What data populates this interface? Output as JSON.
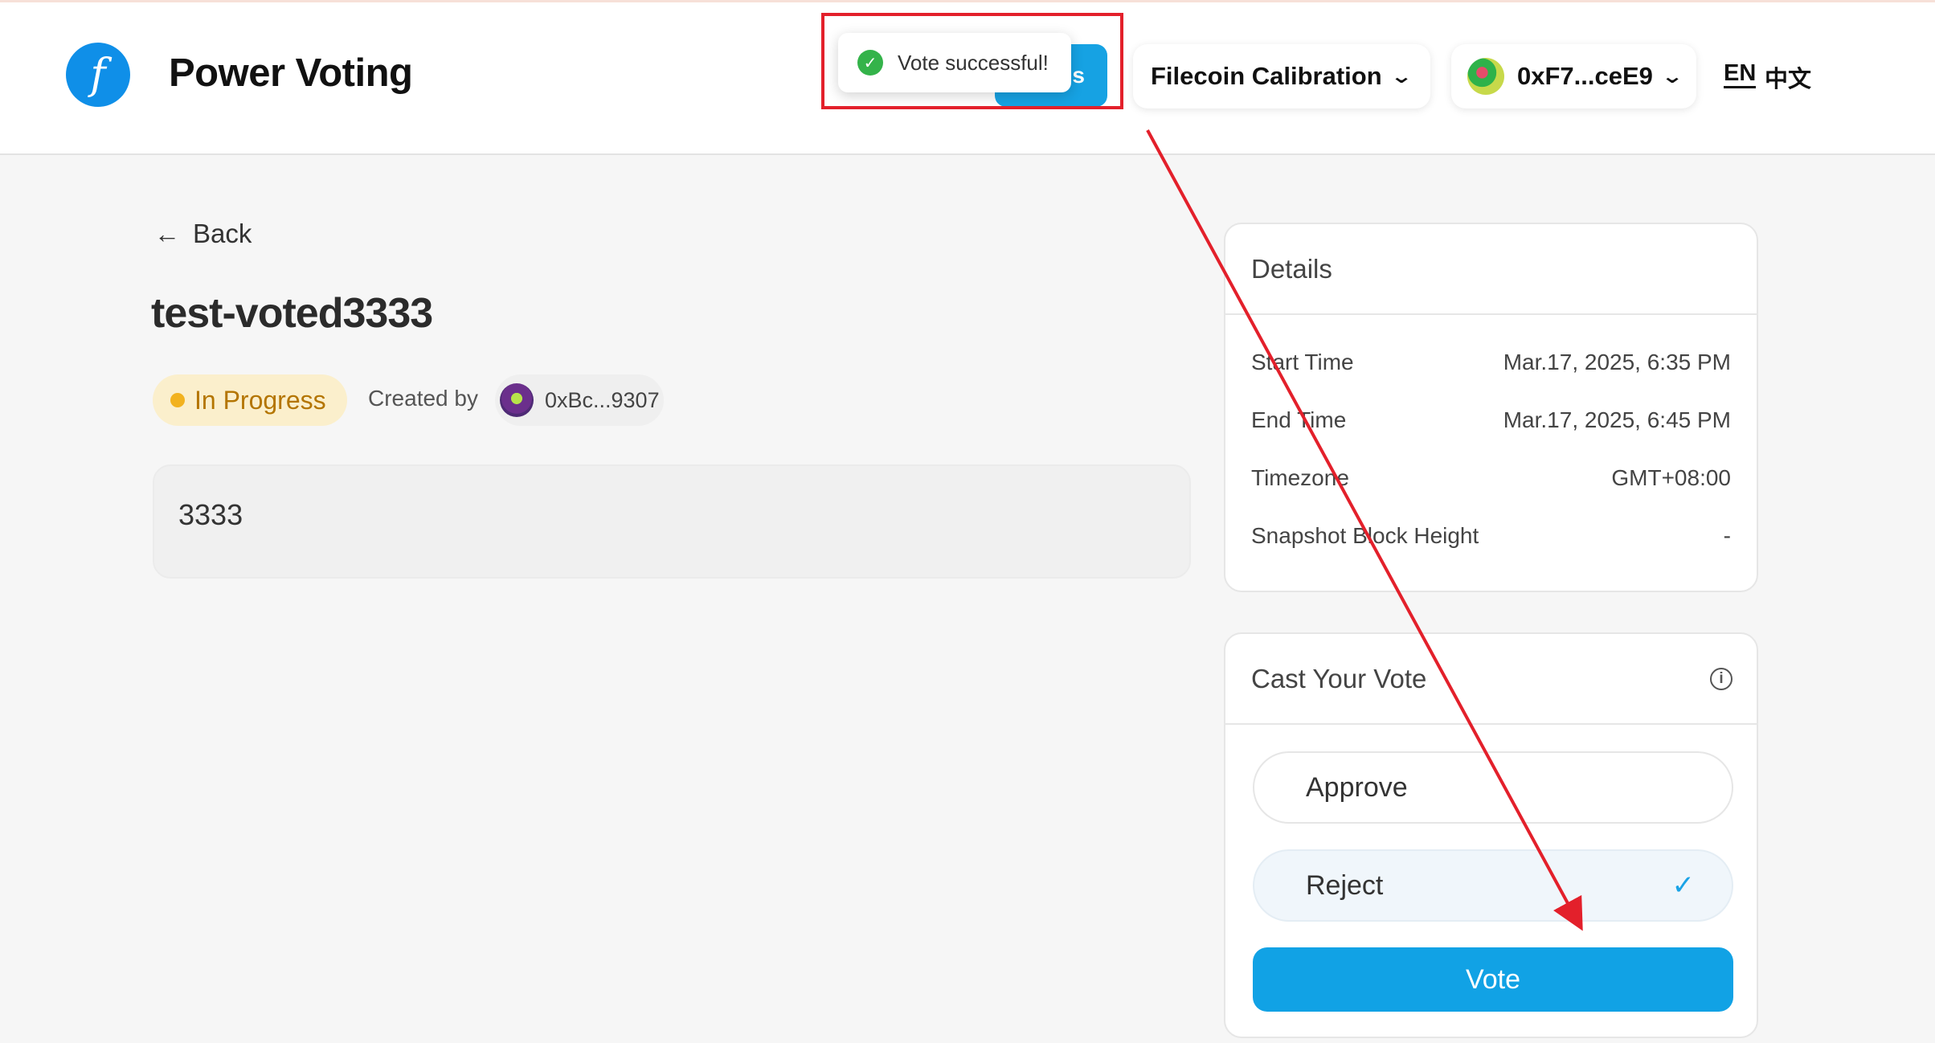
{
  "header": {
    "logo_glyph": "f",
    "app_title": "Power Voting",
    "hidden_button_tail": "s",
    "toast": {
      "icon": "check-circle-icon",
      "message": "Vote successful!"
    },
    "network": {
      "label": "Filecoin Calibration"
    },
    "wallet": {
      "address": "0xF7...ceE9"
    },
    "lang": {
      "en": "EN",
      "zh": "中文"
    }
  },
  "proposal": {
    "back_label": "Back",
    "title": "test-voted3333",
    "status": "In Progress",
    "created_by_label": "Created by",
    "creator": "0xBc...9307",
    "description": "3333"
  },
  "details": {
    "heading": "Details",
    "rows": [
      {
        "label": "Start Time",
        "value": "Mar.17, 2025, 6:35 PM"
      },
      {
        "label": "End Time",
        "value": "Mar.17, 2025, 6:45 PM"
      },
      {
        "label": "Timezone",
        "value": "GMT+08:00"
      },
      {
        "label": "Snapshot Block Height",
        "value": "-"
      }
    ]
  },
  "vote": {
    "heading": "Cast Your Vote",
    "options": [
      {
        "label": "Approve",
        "selected": false
      },
      {
        "label": "Reject",
        "selected": true
      }
    ],
    "button_label": "Vote"
  },
  "annotation": {
    "color": "#e3202b"
  }
}
